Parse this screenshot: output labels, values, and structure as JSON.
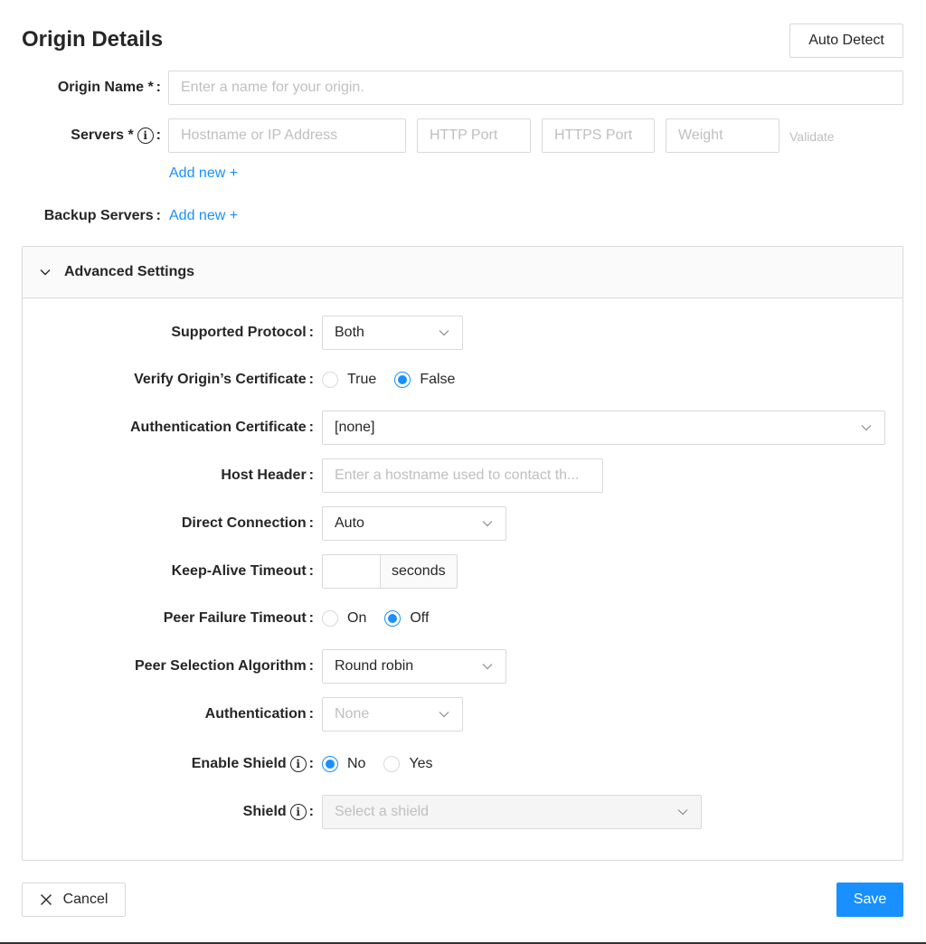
{
  "header": {
    "title": "Origin Details",
    "auto_detect_label": "Auto Detect"
  },
  "origin_name": {
    "label": "Origin Name *",
    "placeholder": "Enter a name for your origin."
  },
  "servers": {
    "label": "Servers *",
    "hostname_placeholder": "Hostname or IP Address",
    "http_port_placeholder": "HTTP Port",
    "https_port_placeholder": "HTTPS Port",
    "weight_placeholder": "Weight",
    "validate_label": "Validate",
    "add_new_label": "Add new +"
  },
  "backup_servers": {
    "label": "Backup Servers",
    "add_new_label": "Add new +"
  },
  "advanced": {
    "title": "Advanced Settings",
    "supported_protocol": {
      "label": "Supported Protocol",
      "value": "Both"
    },
    "verify_certificate": {
      "label": "Verify Origin’s Certificate",
      "options": [
        "True",
        "False"
      ],
      "selected": "False"
    },
    "auth_certificate": {
      "label": "Authentication Certificate",
      "value": "[none]"
    },
    "host_header": {
      "label": "Host Header",
      "placeholder": "Enter a hostname used to contact th..."
    },
    "direct_connection": {
      "label": "Direct Connection",
      "value": "Auto"
    },
    "keep_alive": {
      "label": "Keep-Alive Timeout",
      "value": "",
      "unit": "seconds"
    },
    "peer_failure": {
      "label": "Peer Failure Timeout",
      "options": [
        "On",
        "Off"
      ],
      "selected": "Off"
    },
    "peer_selection": {
      "label": "Peer Selection Algorithm",
      "value": "Round robin"
    },
    "authentication": {
      "label": "Authentication",
      "placeholder": "None"
    },
    "enable_shield": {
      "label": "Enable Shield",
      "options": [
        "No",
        "Yes"
      ],
      "selected": "No"
    },
    "shield": {
      "label": "Shield",
      "placeholder": "Select a shield"
    }
  },
  "footer": {
    "cancel_label": "Cancel",
    "save_label": "Save"
  },
  "colors": {
    "primary": "#1890ff",
    "border": "#d9d9d9",
    "placeholder": "#bfbfbf"
  }
}
